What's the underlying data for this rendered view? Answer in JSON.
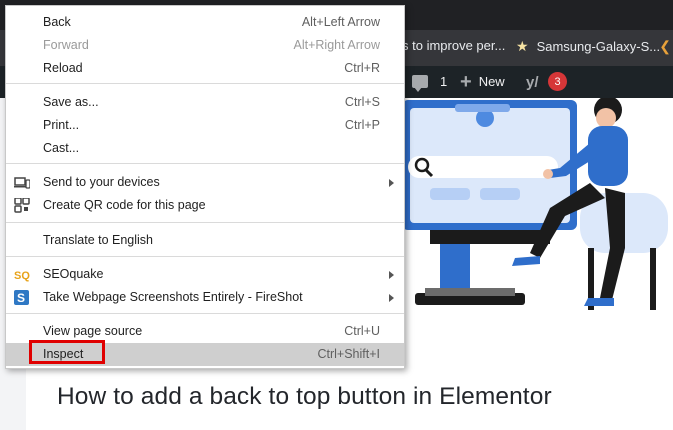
{
  "bookmarks": {
    "item1": "s to improve per...",
    "item2": "Samsung-Galaxy-S..."
  },
  "admin_bar": {
    "comments_count": "1",
    "new_label": "New",
    "notifications_count": "3"
  },
  "context_menu": {
    "items": [
      {
        "label": "Back",
        "shortcut": "Alt+Left Arrow"
      },
      {
        "label": "Forward",
        "shortcut": "Alt+Right Arrow"
      },
      {
        "label": "Reload",
        "shortcut": "Ctrl+R"
      },
      {
        "label": "Save as...",
        "shortcut": "Ctrl+S"
      },
      {
        "label": "Print...",
        "shortcut": "Ctrl+P"
      },
      {
        "label": "Cast..."
      },
      {
        "label": "Send to your devices"
      },
      {
        "label": "Create QR code for this page"
      },
      {
        "label": "Translate to English"
      },
      {
        "label": "SEOquake"
      },
      {
        "label": "Take Webpage Screenshots Entirely - FireShot"
      },
      {
        "label": "View page source",
        "shortcut": "Ctrl+U"
      },
      {
        "label": "Inspect",
        "shortcut": "Ctrl+Shift+I"
      }
    ]
  },
  "article": {
    "title": "How to add a back to top button in Elementor"
  },
  "colors": {
    "highlight": "#cfcfcf",
    "callout_border": "#e00000",
    "badge": "#d63638",
    "illustration_blue": "#2f6ecb"
  }
}
